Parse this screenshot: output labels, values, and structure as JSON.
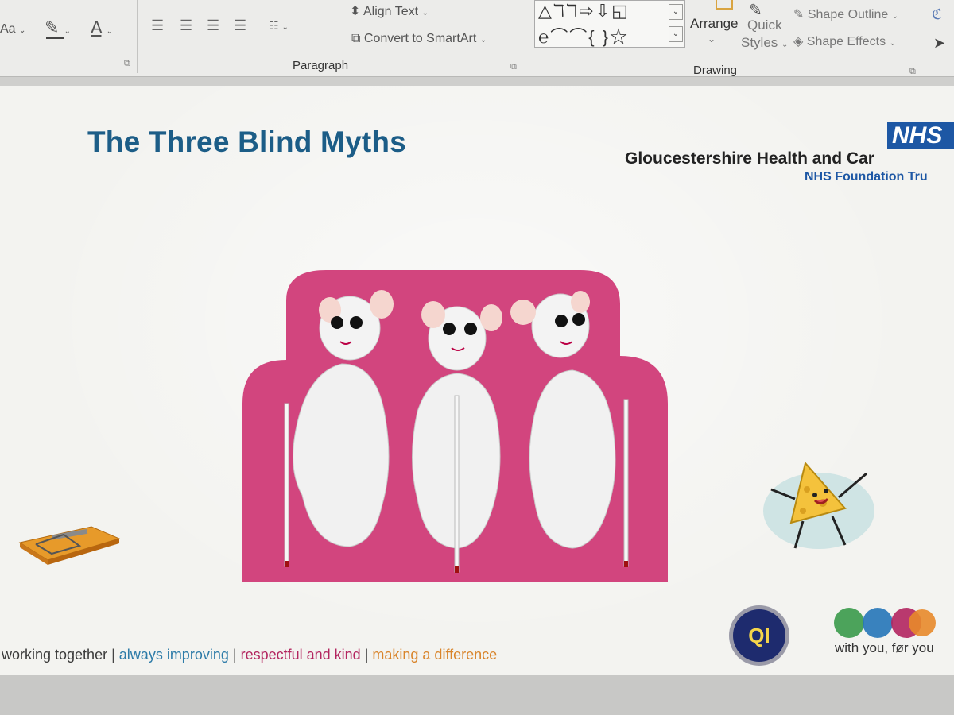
{
  "ribbon": {
    "font_size_label": "Aa",
    "align_text_label": "Align Text",
    "convert_smartart_label": "Convert to SmartArt",
    "paragraph_group_label": "Paragraph",
    "drawing_group_label": "Drawing",
    "arrange_label": "Arrange",
    "quick_styles_label_1": "Quick",
    "quick_styles_label_2": "Styles",
    "shape_outline_label": "Shape Outline",
    "shape_effects_label": "Shape Effects",
    "shape_row_1": "△ℸℸ⇨⇩◱",
    "shape_row_2": "℮⌒⌒{ }☆"
  },
  "slide": {
    "title": "The Three Blind Myths",
    "logo_text": "NHS",
    "org_name": "Gloucestershire Health and Car",
    "org_sub": "NHS Foundation Tru",
    "values": {
      "v1": "working together",
      "v2": "always improving",
      "v3": "respectful and kind",
      "v4": "making a difference",
      "pipe": "|"
    },
    "qi_badge_text": "QI",
    "tagline": "with you, før you"
  },
  "colors": {
    "title": "#1c5d87",
    "nhs_blue": "#1d57a4",
    "sofa_pink": "#d2457e",
    "value_teal": "#2d7ba8",
    "value_magenta": "#b3255f",
    "value_orange": "#d9842a"
  }
}
